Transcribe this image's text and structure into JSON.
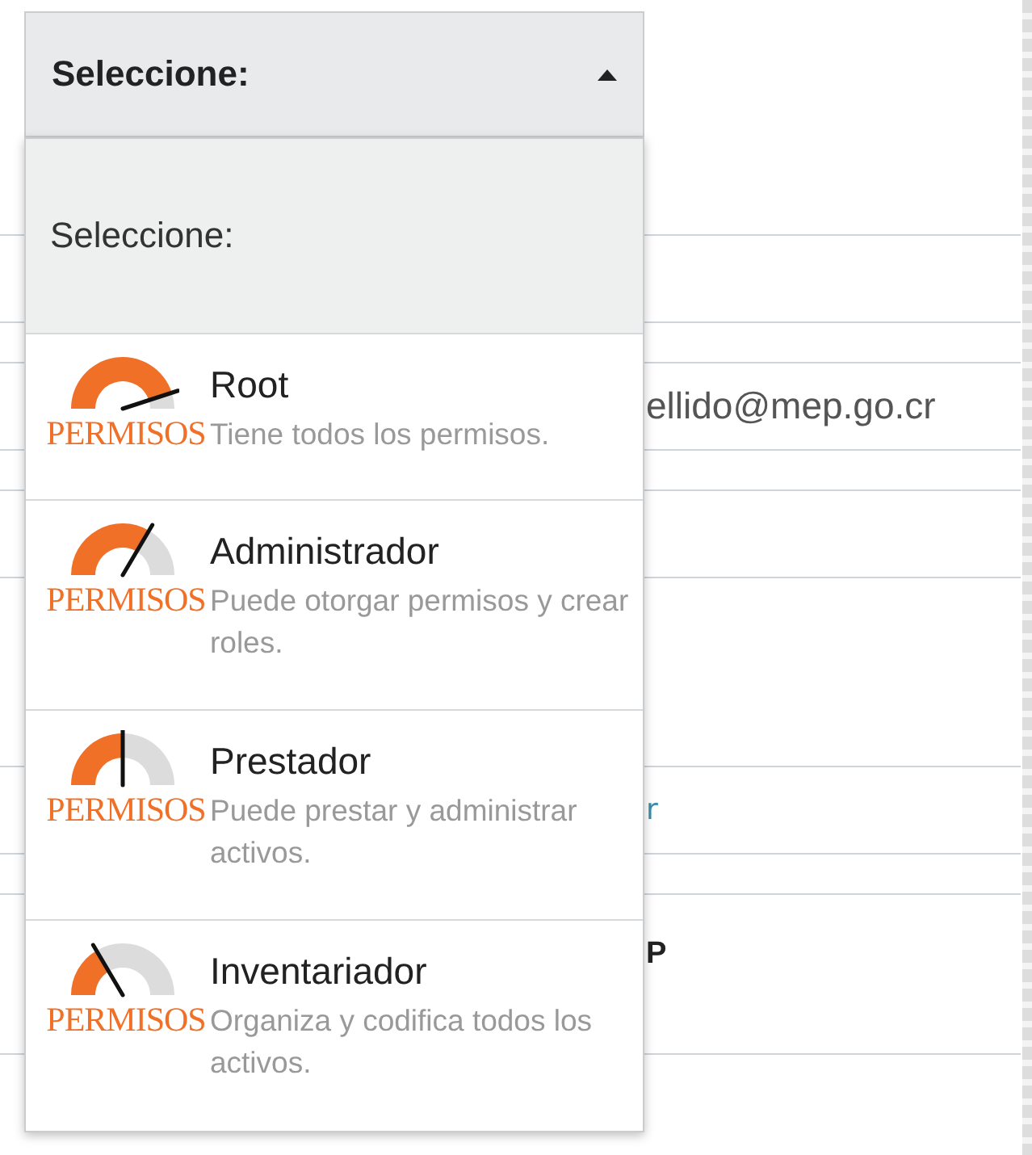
{
  "dropdown": {
    "value": "Seleccione:",
    "expanded": true,
    "placeholder_option": "Seleccione:",
    "options": [
      {
        "logo_text": "PERMISOS",
        "name": "Root",
        "description": "Tiene todos los permisos."
      },
      {
        "logo_text": "PERMISOS",
        "name": "Administrador",
        "description": "Puede otorgar permisos y crear roles."
      },
      {
        "logo_text": "PERMISOS",
        "name": "Prestador",
        "description": "Puede prestar y administrar activos."
      },
      {
        "logo_text": "PERMISOS",
        "name": "Inventariador",
        "description": "Organiza y codifica todos los activos."
      }
    ]
  },
  "table": {
    "fragments": [
      {
        "kind": "email",
        "text": "ellido@mep.go.cr"
      },
      {
        "kind": "link",
        "text": "r"
      },
      {
        "kind": "heading",
        "text": "P"
      }
    ]
  }
}
